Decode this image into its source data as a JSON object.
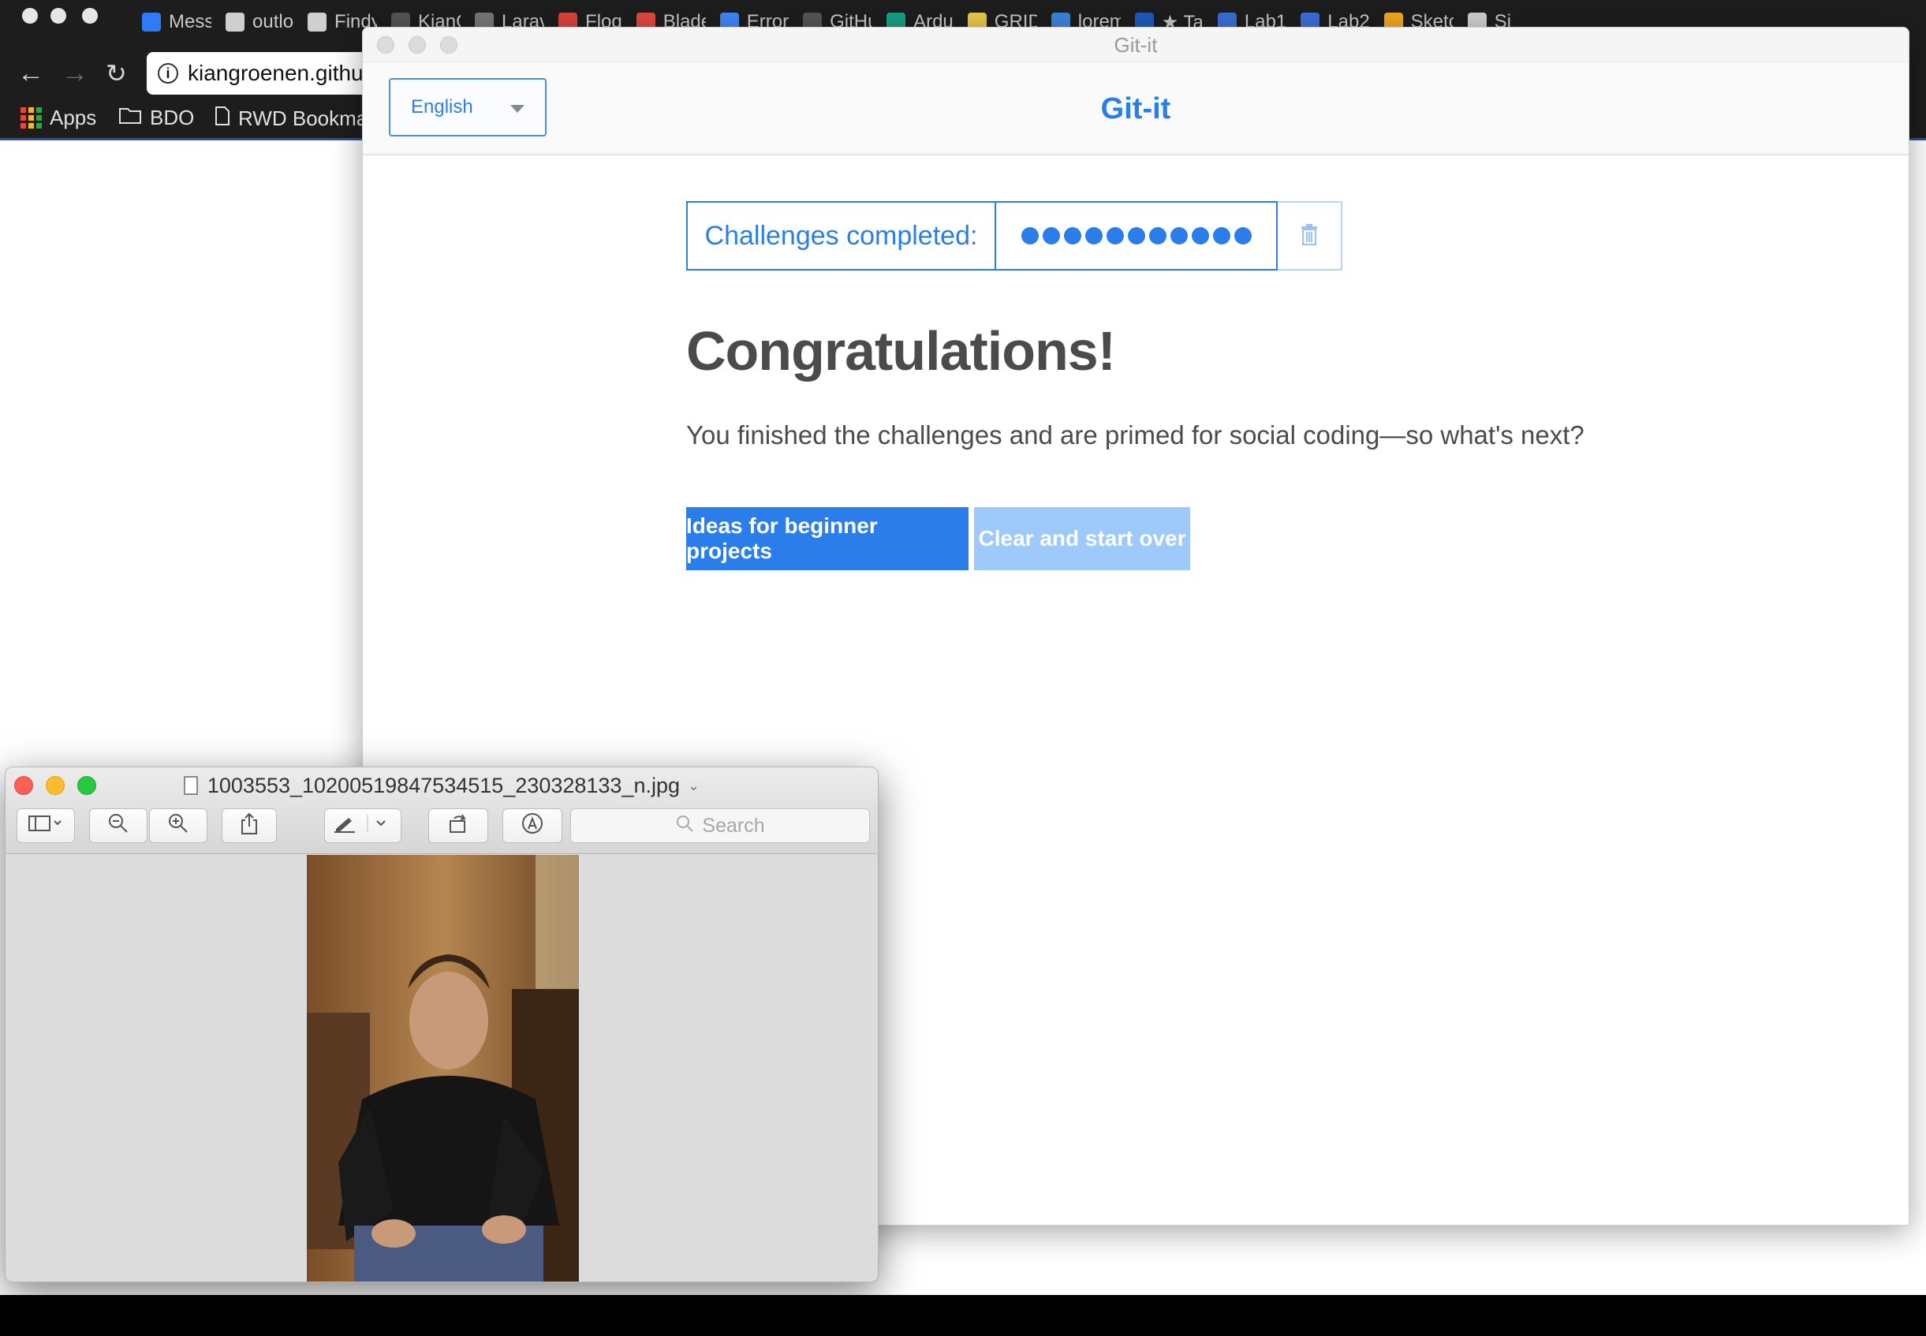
{
  "chrome": {
    "tabs": [
      "Mess",
      "outlo",
      "Findy",
      "KianG",
      "Larav",
      "Floq",
      "Blade",
      "Error",
      "GitHu",
      "Ardu",
      "GRID",
      "lorem",
      "★ Ta",
      "Lab1",
      "Lab2",
      "Sketc",
      "Si"
    ],
    "url": "kiangroenen.githu",
    "bookmarks": [
      "Apps",
      "BDO",
      "RWD Bookma"
    ]
  },
  "gitit": {
    "window_title": "Git-it",
    "language": "English",
    "app_title": "Git-it",
    "progress_label": "Challenges completed:",
    "completed_count": 11,
    "heading": "Congratulations!",
    "message": "You finished the challenges and are primed for social coding—so what's next?",
    "btn_ideas": "Ideas for beginner projects",
    "btn_clear": "Clear and start over",
    "colors": {
      "accent": "#2b7de9",
      "accent_light": "#9dc9fb",
      "text": "#4b4b4b"
    }
  },
  "preview": {
    "filename": "1003553_10200519847534515_230328133_n.jpg",
    "search_placeholder": "Search"
  }
}
